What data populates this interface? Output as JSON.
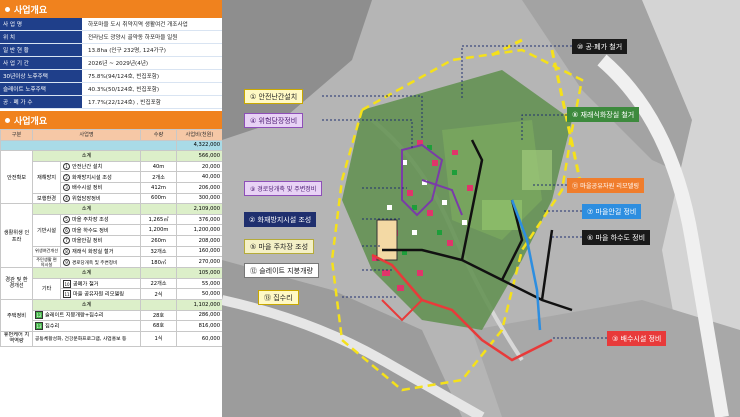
{
  "overview": {
    "title": "사업개요",
    "rows": [
      {
        "k": "사 업 명",
        "v": "하포마을 도시 취약지역 생활여건 개조사업"
      },
      {
        "k": "위 치",
        "v": "전라남도 광양시 골약동 하포마을 일원"
      },
      {
        "k": "일 반 현 황",
        "v": "13.8ha (인구 232명, 124가구)"
      },
      {
        "k": "사 업 기 간",
        "v": "2026년 ~ 2029년(4년)"
      },
      {
        "k": "30년이상 노후주택",
        "v": "75.8%(94/124호, 빈집포함)"
      },
      {
        "k": "슬레이트 노후주택",
        "v": "40.3%(50/124호, 빈집포함)"
      },
      {
        "k": "공 · 폐 가 수",
        "v": "17.7%(22/124호) , 빈집포함"
      }
    ]
  },
  "plan": {
    "title": "사업개요",
    "headers": [
      "구분",
      "사업명",
      "수량",
      "사업비(천원)"
    ],
    "total": "4,322,000",
    "subtotal_label": "소계",
    "groups": [
      {
        "name": "안전확보",
        "subtotal": "566,000",
        "items": [
          {
            "cat": "재해방지",
            "num": "1",
            "name": "안전난간 설치",
            "qty": "40m",
            "cost": "20,000"
          },
          {
            "cat": "",
            "num": "2",
            "name": "화재방지시설 조성",
            "qty": "2개소",
            "cost": "40,000"
          },
          {
            "cat": "",
            "num": "3",
            "name": "배수시설 정비",
            "qty": "412m",
            "cost": "206,000"
          },
          {
            "cat": "보행환경",
            "num": "4",
            "name": "위험담장정비",
            "qty": "600m",
            "cost": "300,000"
          }
        ]
      },
      {
        "name": "생활위생 인프라",
        "subtotal": "2,109,000",
        "items": [
          {
            "cat": "기반시설",
            "num": "5",
            "name": "마을 주차장 조성",
            "qty": "1,265㎡",
            "cost": "376,000"
          },
          {
            "cat": "",
            "num": "6",
            "name": "마을 하수도 정비",
            "qty": "1,200m",
            "cost": "1,200,000"
          },
          {
            "cat": "",
            "num": "7",
            "name": "마을안길 정비",
            "qty": "260m",
            "cost": "208,000"
          },
          {
            "cat": "위생여건개선",
            "num": "8",
            "name": "재래식 화장실 철거",
            "qty": "32개소",
            "cost": "160,000"
          },
          {
            "cat": "주민생활 편의시설",
            "num": "9",
            "name": "경로당개축 및 주변정비",
            "qty": "180㎡",
            "cost": "270,000"
          }
        ]
      },
      {
        "name": "경관 및 환경개선",
        "subtotal": "105,000",
        "items": [
          {
            "cat": "기타",
            "num": "10",
            "name": "공폐가 철거",
            "qty": "22개소",
            "cost": "55,000"
          },
          {
            "cat": "",
            "num": "11",
            "name": "마을 공유자원 리모델링",
            "qty": "2식",
            "cost": "50,000"
          }
        ]
      },
      {
        "name": "주택정비",
        "subtotal": "1,102,000",
        "items": [
          {
            "cat": "",
            "num": "12",
            "name": "슬레이트 지붕개량+집수리",
            "qty": "28호",
            "cost": "286,000"
          },
          {
            "cat": "",
            "num": "13",
            "name": "집수리",
            "qty": "68호",
            "cost": "816,000"
          }
        ]
      }
    ],
    "last_row": {
      "name": "휴먼케어 지역역량",
      "item": "공동체활성화, 건강문화프로그램, 사업홍보 등",
      "qty": "1식",
      "cost": "60,000"
    }
  },
  "map_labels": [
    {
      "id": "1",
      "text": "① 안전난간설치"
    },
    {
      "id": "4",
      "text": "④ 위험담장정비"
    },
    {
      "id": "9",
      "text": "⑨ 경로당개축 및 주변정비"
    },
    {
      "id": "2",
      "text": "② 화재방지시설 조성"
    },
    {
      "id": "5",
      "text": "⑤ 마을 주차장 조성"
    },
    {
      "id": "12",
      "text": "⑫ 슬레이트 지붕개량"
    },
    {
      "id": "13",
      "text": "⑬ 집수리"
    },
    {
      "id": "10",
      "text": "⑩ 공·폐가 철거"
    },
    {
      "id": "8",
      "text": "⑧ 재래식화장실 철거"
    },
    {
      "id": "11",
      "text": "⑪ 마을공유자원 리모델링"
    },
    {
      "id": "7",
      "text": "⑦ 마을안길 정비"
    },
    {
      "id": "6",
      "text": "⑥ 마을 하수도 정비"
    },
    {
      "id": "3",
      "text": "③ 배수시설 정비"
    }
  ]
}
